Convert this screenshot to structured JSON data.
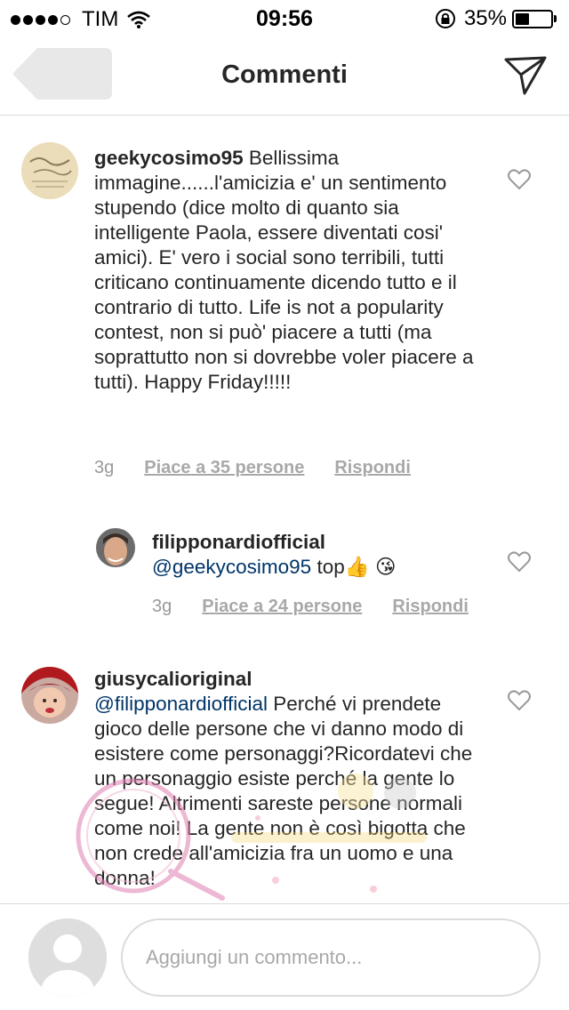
{
  "status_bar": {
    "carrier": "TIM",
    "time": "09:56",
    "battery": "35%"
  },
  "header": {
    "title": "Commenti"
  },
  "comments": [
    {
      "username": "geekycosimo95",
      "text": " Bellissima immagine......l'amicizia e' un sentimento stupendo (dice molto di quanto sia intelligente Paola, essere diventati cosi' amici). E' vero i social sono terribili, tutti criticano continuamente dicendo tutto e il contrario di tutto. Life is not a popularity contest, non si può' piacere a tutti (ma soprattutto non si dovrebbe voler piacere a tutti). Happy Friday!!!!!",
      "time": "3g",
      "likes": "Piace a 35 persone",
      "reply": "Rispondi"
    },
    {
      "username": "filipponardiofficial",
      "mention": "@geekycosimo95",
      "text": " top👍 😘",
      "time": "3g",
      "likes": "Piace a 24 persone",
      "reply": "Rispondi"
    },
    {
      "username": "giusycalioriginal",
      "mention": "@filipponardiofficial",
      "text": " Perché vi prendete gioco delle persone che vi danno modo di esistere come personaggi?Ricordatevi che un personaggio esiste perché la gente lo segue! Altrimenti sareste persone normali come noi! La gente non è così bigotta che non crede all'amicizia fra un uomo e una donna!"
    }
  ],
  "comment_input": {
    "placeholder": "Aggiungi un commento..."
  },
  "icons": {
    "back": "back-arrow-icon",
    "send": "paper-plane-icon",
    "like": "heart-outline-icon",
    "wifi": "wifi-icon",
    "lock": "rotation-lock-icon"
  },
  "colors": {
    "mention": "#003569",
    "meta": "#999999",
    "divider": "#dbdbdb"
  }
}
